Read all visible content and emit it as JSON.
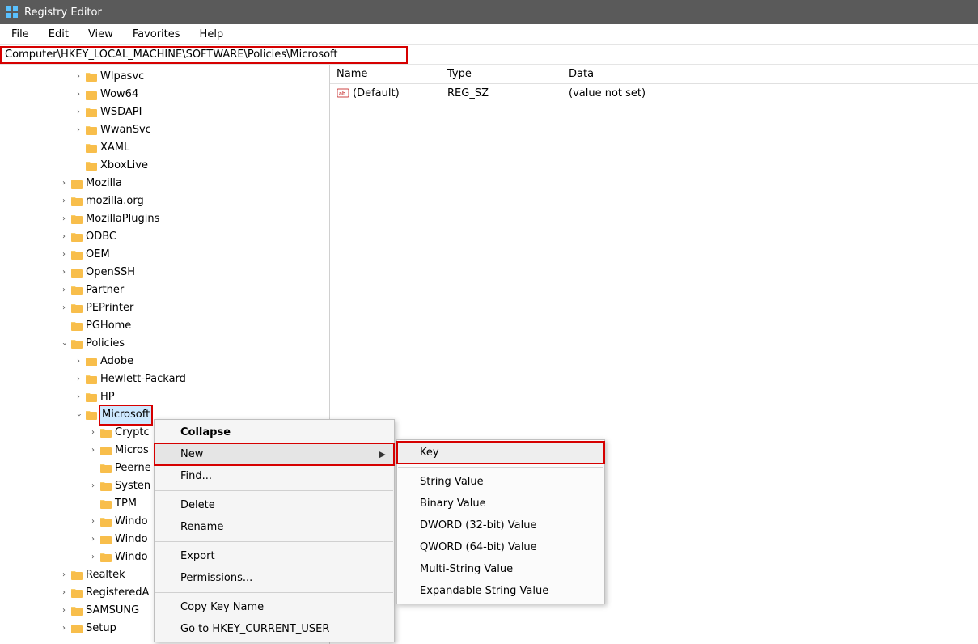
{
  "window": {
    "title": "Registry Editor"
  },
  "menubar": {
    "file": "File",
    "edit": "Edit",
    "view": "View",
    "favorites": "Favorites",
    "help": "Help"
  },
  "address": "Computer\\HKEY_LOCAL_MACHINE\\SOFTWARE\\Policies\\Microsoft",
  "tree": {
    "indent_unit": 18,
    "nodes": [
      {
        "label": "Wlpasvc",
        "depth": 5,
        "exp": ">"
      },
      {
        "label": "Wow64",
        "depth": 5,
        "exp": ">"
      },
      {
        "label": "WSDAPI",
        "depth": 5,
        "exp": ">"
      },
      {
        "label": "WwanSvc",
        "depth": 5,
        "exp": ">"
      },
      {
        "label": "XAML",
        "depth": 5,
        "exp": ""
      },
      {
        "label": "XboxLive",
        "depth": 5,
        "exp": ""
      },
      {
        "label": "Mozilla",
        "depth": 4,
        "exp": ">"
      },
      {
        "label": "mozilla.org",
        "depth": 4,
        "exp": ">"
      },
      {
        "label": "MozillaPlugins",
        "depth": 4,
        "exp": ">"
      },
      {
        "label": "ODBC",
        "depth": 4,
        "exp": ">"
      },
      {
        "label": "OEM",
        "depth": 4,
        "exp": ">"
      },
      {
        "label": "OpenSSH",
        "depth": 4,
        "exp": ">"
      },
      {
        "label": "Partner",
        "depth": 4,
        "exp": ">"
      },
      {
        "label": "PEPrinter",
        "depth": 4,
        "exp": ">"
      },
      {
        "label": "PGHome",
        "depth": 4,
        "exp": ""
      },
      {
        "label": "Policies",
        "depth": 4,
        "exp": "v"
      },
      {
        "label": "Adobe",
        "depth": 5,
        "exp": ">"
      },
      {
        "label": "Hewlett-Packard",
        "depth": 5,
        "exp": ">"
      },
      {
        "label": "HP",
        "depth": 5,
        "exp": ">"
      },
      {
        "label": "Microsoft",
        "depth": 5,
        "exp": "v",
        "selected": true
      },
      {
        "label": "Cryptc",
        "depth": 6,
        "exp": ">"
      },
      {
        "label": "Micros",
        "depth": 6,
        "exp": ">"
      },
      {
        "label": "Peerne",
        "depth": 6,
        "exp": ""
      },
      {
        "label": "Systen",
        "depth": 6,
        "exp": ">"
      },
      {
        "label": "TPM",
        "depth": 6,
        "exp": ""
      },
      {
        "label": "Windo",
        "depth": 6,
        "exp": ">"
      },
      {
        "label": "Windo",
        "depth": 6,
        "exp": ">"
      },
      {
        "label": "Windo",
        "depth": 6,
        "exp": ">"
      },
      {
        "label": "Realtek",
        "depth": 4,
        "exp": ">"
      },
      {
        "label": "RegisteredA",
        "depth": 4,
        "exp": ">"
      },
      {
        "label": "SAMSUNG",
        "depth": 4,
        "exp": ">"
      },
      {
        "label": "Setup",
        "depth": 4,
        "exp": ">"
      }
    ]
  },
  "values": {
    "headers": {
      "name": "Name",
      "type": "Type",
      "data": "Data"
    },
    "rows": [
      {
        "name": "(Default)",
        "type": "REG_SZ",
        "data": "(value not set)"
      }
    ]
  },
  "context_menu": {
    "collapse": "Collapse",
    "new": "New",
    "find": "Find...",
    "delete": "Delete",
    "rename": "Rename",
    "export": "Export",
    "permissions": "Permissions...",
    "copy_key_name": "Copy Key Name",
    "goto": "Go to HKEY_CURRENT_USER"
  },
  "submenu_new": {
    "key": "Key",
    "string": "String Value",
    "binary": "Binary Value",
    "dword": "DWORD (32-bit) Value",
    "qword": "QWORD (64-bit) Value",
    "multi": "Multi-String Value",
    "expand": "Expandable String Value"
  }
}
